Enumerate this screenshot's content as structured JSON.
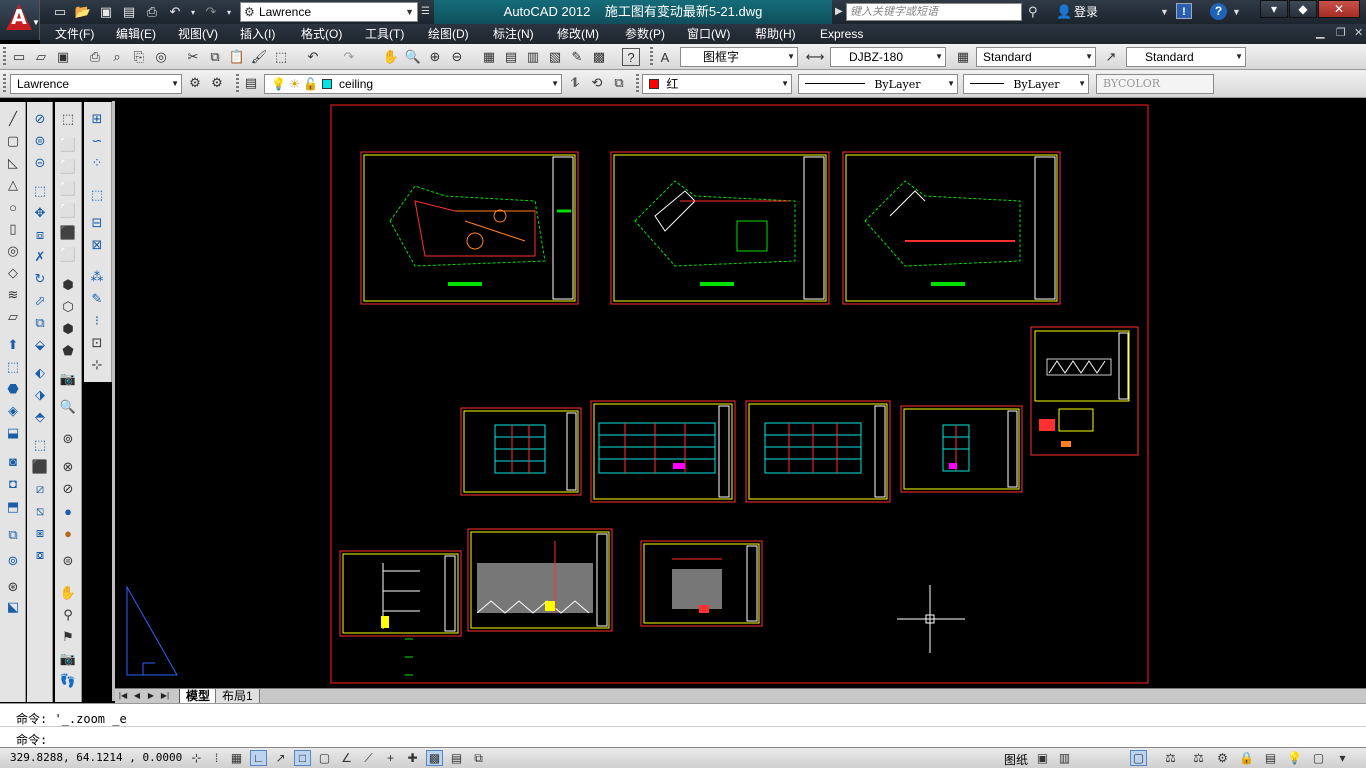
{
  "title_bar": {
    "app_title": "AutoCAD 2012",
    "doc_title": "施工图有变动最新5-21.dwg",
    "workspace": "Lawrence",
    "search_placeholder": "键入关键字或短语",
    "login": "登录"
  },
  "menu": [
    "文件(F)",
    "编辑(E)",
    "视图(V)",
    "插入(I)",
    "格式(O)",
    "工具(T)",
    "绘图(D)",
    "标注(N)",
    "修改(M)",
    "参数(P)",
    "窗口(W)",
    "帮助(H)",
    "Express"
  ],
  "styles_toolbar": {
    "text_style": "图框字",
    "dim_style": "DJBZ-180",
    "table_style": "Standard",
    "mleader_style": "Standard"
  },
  "layers_toolbar": {
    "workspace": "Lawrence",
    "layer": "ceiling",
    "color": "红",
    "linetype": "ByLayer",
    "lineweight": "ByLayer",
    "plotstyle": "BYCOLOR"
  },
  "layout_tabs": [
    "模型",
    "布局1"
  ],
  "command": {
    "history": "命令: '_.zoom _e",
    "prompt": "命令:"
  },
  "status": {
    "coords": "329.8288, 64.1214 , 0.0000",
    "paper_label": "图纸"
  },
  "colors": {
    "title_bg": "#1c242d",
    "canvas_bg": "#000000",
    "frame_red": "#ff2020",
    "sheet_yellow": "#ffff00"
  }
}
